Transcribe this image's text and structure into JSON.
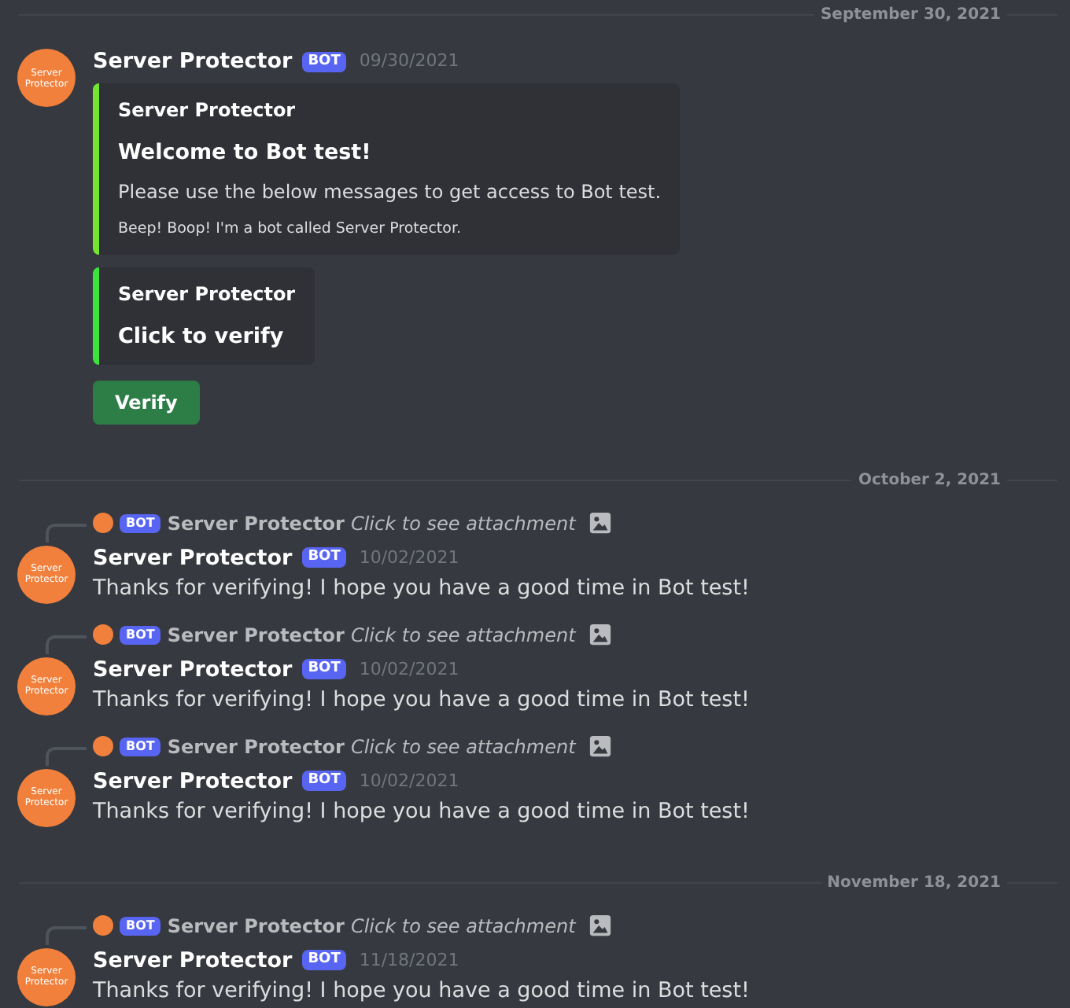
{
  "feed": [
    {
      "kind": "divider",
      "date": "September 30, 2021"
    },
    {
      "kind": "message",
      "avatar_text": "Server Protector",
      "author": "Server Protector",
      "badge": "BOT",
      "timestamp": "09/30/2021",
      "embeds": [
        {
          "color": "#76e432",
          "author": "Server Protector",
          "title": "Welcome to Bot test!",
          "description": "Please use the below messages to get access to Bot test.",
          "footer": "Beep! Boop! I'm a bot called Server Protector."
        },
        {
          "color": "#3ee23e",
          "author": "Server Protector",
          "title": "Click to verify"
        }
      ],
      "button": "Verify"
    },
    {
      "kind": "divider",
      "date": "October 2, 2021"
    },
    {
      "kind": "message",
      "reply": {
        "badge": "BOT",
        "author": "Server Protector",
        "text": "Click to see attachment"
      },
      "avatar_text": "Server Protector",
      "author": "Server Protector",
      "badge": "BOT",
      "timestamp": "10/02/2021",
      "content": "Thanks for verifying! I hope you have a good time in Bot test!"
    },
    {
      "kind": "message",
      "reply": {
        "badge": "BOT",
        "author": "Server Protector",
        "text": "Click to see attachment"
      },
      "avatar_text": "Server Protector",
      "author": "Server Protector",
      "badge": "BOT",
      "timestamp": "10/02/2021",
      "content": "Thanks for verifying! I hope you have a good time in Bot test!"
    },
    {
      "kind": "message",
      "reply": {
        "badge": "BOT",
        "author": "Server Protector",
        "text": "Click to see attachment"
      },
      "avatar_text": "Server Protector",
      "author": "Server Protector",
      "badge": "BOT",
      "timestamp": "10/02/2021",
      "content": "Thanks for verifying! I hope you have a good time in Bot test!"
    },
    {
      "kind": "divider",
      "date": "November 18, 2021"
    },
    {
      "kind": "message",
      "reply": {
        "badge": "BOT",
        "author": "Server Protector",
        "text": "Click to see attachment"
      },
      "avatar_text": "Server Protector",
      "author": "Server Protector",
      "badge": "BOT",
      "timestamp": "11/18/2021",
      "content": "Thanks for verifying! I hope you have a good time in Bot test!"
    }
  ]
}
